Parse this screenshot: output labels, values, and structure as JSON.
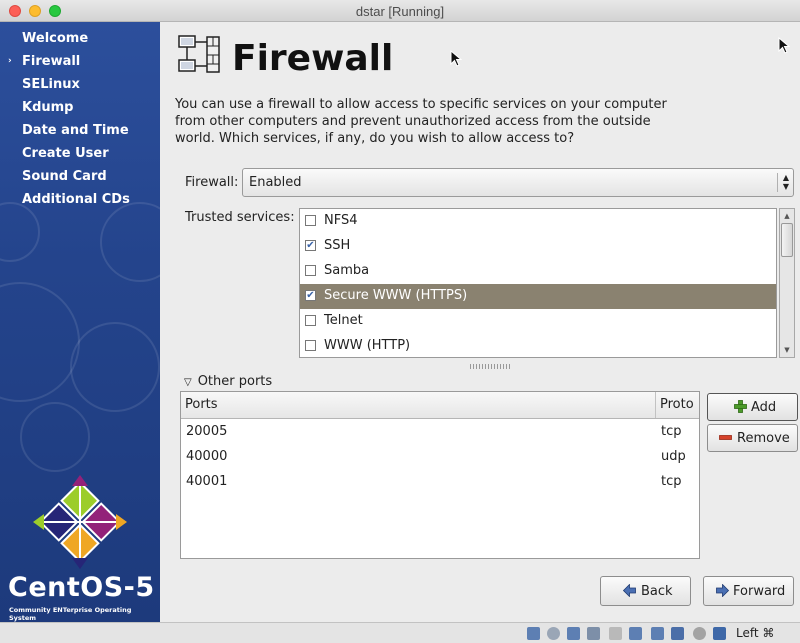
{
  "window": {
    "title": "dstar [Running]"
  },
  "sidebar": {
    "items": [
      {
        "label": "Welcome",
        "current": false
      },
      {
        "label": "Firewall",
        "current": true
      },
      {
        "label": "SELinux",
        "current": false
      },
      {
        "label": "Kdump",
        "current": false
      },
      {
        "label": "Date and Time",
        "current": false
      },
      {
        "label": "Create User",
        "current": false
      },
      {
        "label": "Sound Card",
        "current": false
      },
      {
        "label": "Additional CDs",
        "current": false
      }
    ],
    "current_marker": "›",
    "brand": "CentOS-5",
    "brand_tagline": "Community ENTerprise Operating System"
  },
  "page": {
    "title": "Firewall",
    "icon": "network-firewall-icon",
    "description": "You can use a firewall to allow access to specific services on your computer from other computers and prevent unauthorized access from the outside world.  Which services, if any, do you wish to allow access to?"
  },
  "firewall": {
    "label": "Firewall:",
    "value": "Enabled"
  },
  "trusted": {
    "label": "Trusted services:",
    "services": [
      {
        "name": "NFS4",
        "checked": false,
        "selected": false
      },
      {
        "name": "SSH",
        "checked": true,
        "selected": false
      },
      {
        "name": "Samba",
        "checked": false,
        "selected": false
      },
      {
        "name": "Secure WWW (HTTPS)",
        "checked": true,
        "selected": true
      },
      {
        "name": "Telnet",
        "checked": false,
        "selected": false
      },
      {
        "name": "WWW (HTTP)",
        "checked": false,
        "selected": false
      }
    ]
  },
  "other_ports": {
    "label": "Other ports",
    "columns": {
      "ports": "Ports",
      "proto": "Proto"
    },
    "rows": [
      {
        "port": "20005",
        "proto": "tcp"
      },
      {
        "port": "40000",
        "proto": "udp"
      },
      {
        "port": "40001",
        "proto": "tcp"
      }
    ],
    "add_label": "Add",
    "remove_label": "Remove"
  },
  "nav_buttons": {
    "back": "Back",
    "forward": "Forward"
  },
  "statusbar": {
    "host_key": "Left ⌘"
  },
  "colors": {
    "sidebar": "#24448c",
    "selection": "#8a8270",
    "check": "#3a63a8"
  }
}
